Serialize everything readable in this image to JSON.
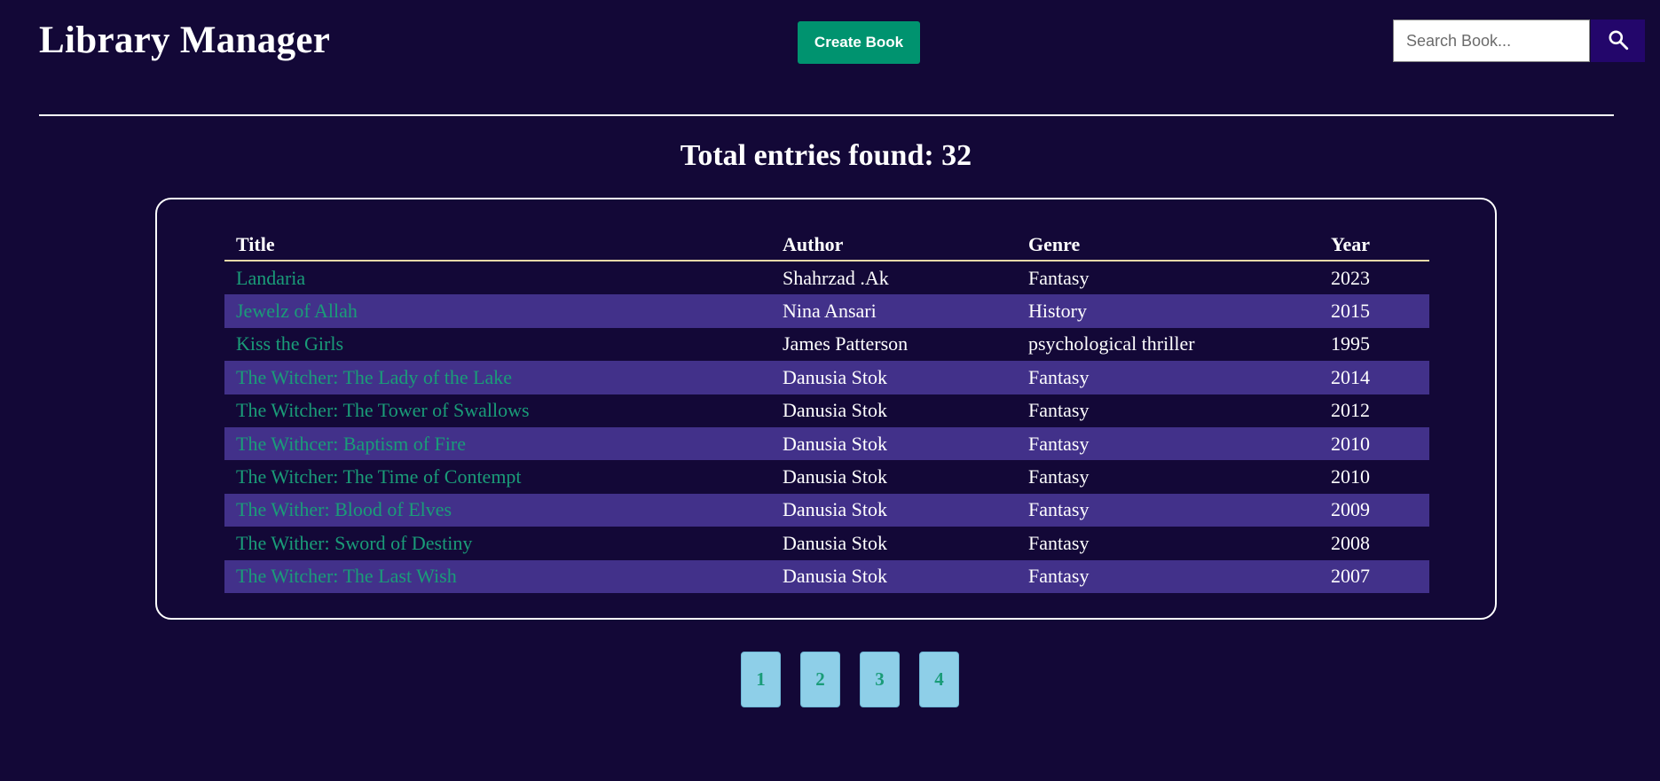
{
  "header": {
    "app_title": "Library Manager",
    "create_button_label": "Create Book",
    "search_placeholder": "Search Book...",
    "search_value": "",
    "search_icon": "magnifier-icon"
  },
  "summary": {
    "total_entries_text": "Total entries found: 32"
  },
  "table": {
    "columns": [
      "Title",
      "Author",
      "Genre",
      "Year"
    ],
    "rows": [
      {
        "title": "Landaria",
        "author": "Shahrzad .Ak",
        "genre": "Fantasy",
        "year": "2023"
      },
      {
        "title": "Jewelz of Allah",
        "author": "Nina Ansari",
        "genre": "History",
        "year": "2015"
      },
      {
        "title": "Kiss the Girls",
        "author": "James Patterson",
        "genre": "psychological thriller",
        "year": "1995"
      },
      {
        "title": "The Witcher: The Lady of the Lake",
        "author": "Danusia Stok",
        "genre": "Fantasy",
        "year": "2014"
      },
      {
        "title": "The Witcher: The Tower of Swallows",
        "author": "Danusia Stok",
        "genre": "Fantasy",
        "year": "2012"
      },
      {
        "title": "The Withcer: Baptism of Fire",
        "author": "Danusia Stok",
        "genre": "Fantasy",
        "year": "2010"
      },
      {
        "title": "The Witcher: The Time of Contempt",
        "author": "Danusia Stok",
        "genre": "Fantasy",
        "year": "2010"
      },
      {
        "title": "The Wither: Blood of Elves",
        "author": "Danusia Stok",
        "genre": "Fantasy",
        "year": "2009"
      },
      {
        "title": "The Wither: Sword of Destiny",
        "author": "Danusia Stok",
        "genre": "Fantasy",
        "year": "2008"
      },
      {
        "title": "The Witcher: The Last Wish",
        "author": "Danusia Stok",
        "genre": "Fantasy",
        "year": "2007"
      }
    ]
  },
  "pagination": {
    "pages": [
      "1",
      "2",
      "3",
      "4"
    ]
  },
  "colors": {
    "background": "#130837",
    "accent_green": "#00936f",
    "title_link": "#1a9c78",
    "row_stripe": "#42318a",
    "search_button": "#23066b",
    "page_button": "#8ecfe8"
  }
}
